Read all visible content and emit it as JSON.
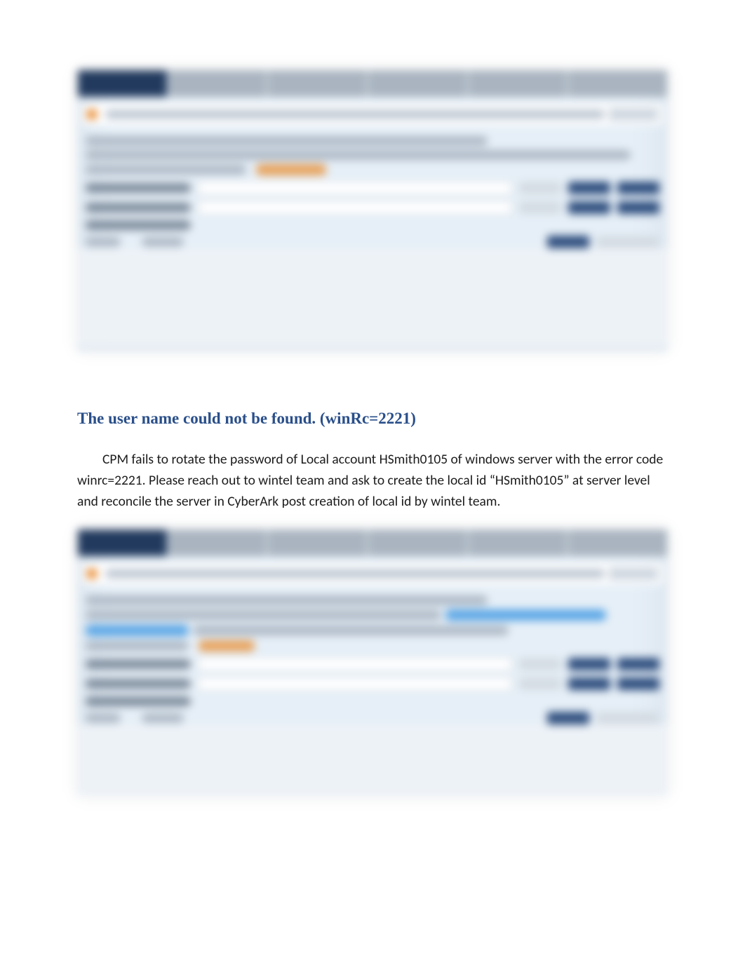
{
  "error_heading": "The user name could not be found. (winRc=2221)",
  "body_paragraph": "CPM fails to rotate the password of Local account HSmith0105 of windows server with the error code winrc=2221. Please reach out to wintel team and ask to create the local id “HSmith0105” at server level and reconcile the server in CyberArk post creation of local id by wintel team."
}
